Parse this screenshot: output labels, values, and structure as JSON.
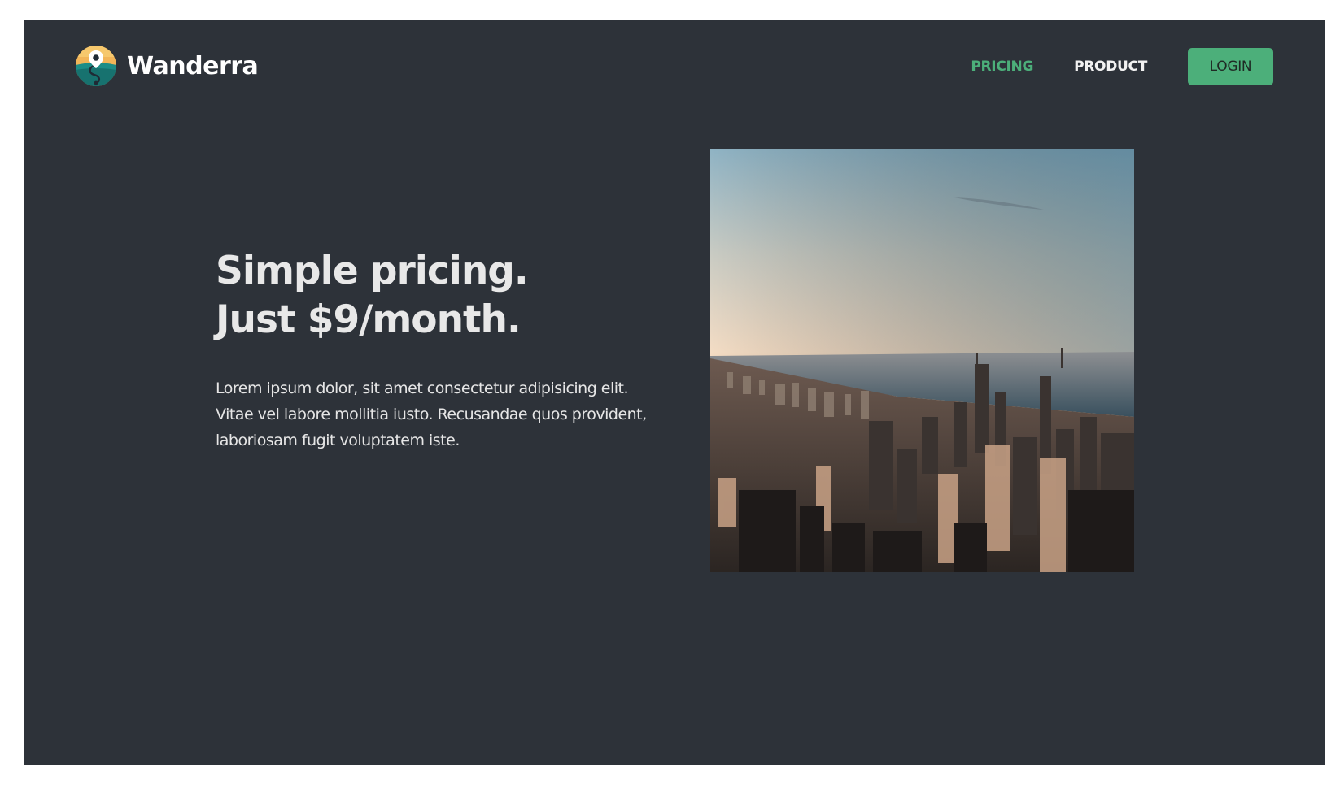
{
  "brand": {
    "name": "Wanderra",
    "logo_icon": "map-pin-logo-icon"
  },
  "nav": {
    "links": [
      {
        "label": "PRICING",
        "active": true
      },
      {
        "label": "PRODUCT",
        "active": false
      }
    ],
    "login_label": "LOGIN"
  },
  "hero": {
    "title_line1": "Simple pricing.",
    "title_line2": "Just $9/month.",
    "body": "Lorem ipsum dolor, sit amet consectetur adipisicing elit. Vitae vel labore mollitia iusto. Recusandae quos provident, laboriosam fugit voluptatem iste.",
    "image_subject": "city-skyline-photo"
  },
  "colors": {
    "background": "#2d3239",
    "accent": "#4caf7a",
    "text": "#e8e8e8"
  }
}
